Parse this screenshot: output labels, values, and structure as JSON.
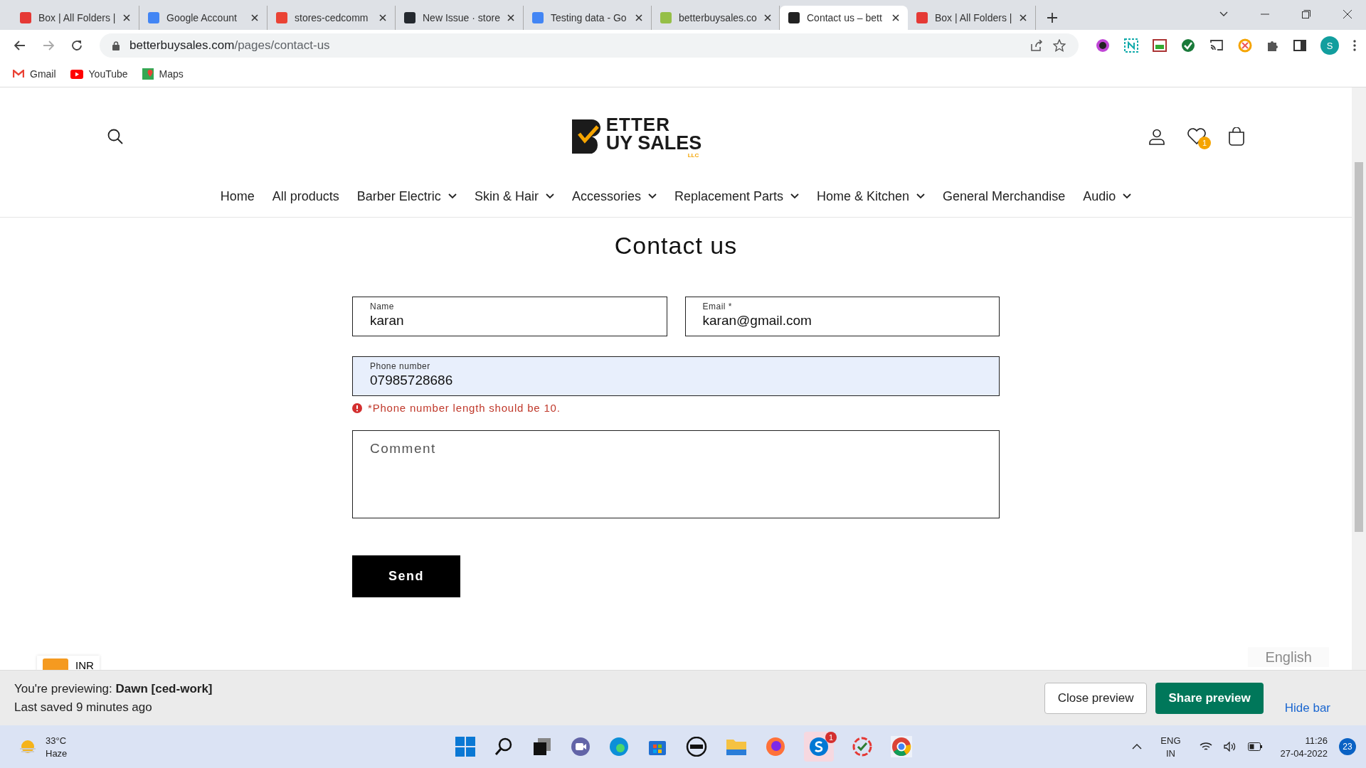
{
  "browser": {
    "tabs": [
      {
        "title": "Box | All Folders |",
        "selected": false
      },
      {
        "title": "Google Account",
        "selected": false
      },
      {
        "title": "stores-cedcomm",
        "selected": false
      },
      {
        "title": "New Issue · store",
        "selected": false
      },
      {
        "title": "Testing data - Go",
        "selected": false
      },
      {
        "title": "betterbuysales.co",
        "selected": false
      },
      {
        "title": "Contact us – bett",
        "selected": true
      },
      {
        "title": "Box | All Folders |",
        "selected": false
      }
    ],
    "url_host": "betterbuysales.com",
    "url_path": "/pages/contact-us",
    "profile_initial": "S",
    "bookmarks": [
      "Gmail",
      "YouTube",
      "Maps"
    ]
  },
  "store": {
    "logo": {
      "line1": "ETTER",
      "line2": "UY SALES",
      "sub": "LLC"
    },
    "wishlist_count": "1",
    "nav": [
      {
        "label": "Home",
        "has_dropdown": false
      },
      {
        "label": "All products",
        "has_dropdown": false
      },
      {
        "label": "Barber Electric",
        "has_dropdown": true
      },
      {
        "label": "Skin & Hair",
        "has_dropdown": true
      },
      {
        "label": "Accessories",
        "has_dropdown": true
      },
      {
        "label": "Replacement Parts",
        "has_dropdown": true
      },
      {
        "label": "Home & Kitchen",
        "has_dropdown": true
      },
      {
        "label": "General Merchandise",
        "has_dropdown": false
      },
      {
        "label": "Audio",
        "has_dropdown": true
      }
    ]
  },
  "contact": {
    "title": "Contact us",
    "name": {
      "label": "Name",
      "value": "karan"
    },
    "email": {
      "label": "Email *",
      "value": "karan@gmail.com"
    },
    "phone": {
      "label": "Phone number",
      "value": "07985728686",
      "invalid": true,
      "error": "*Phone number length should be 10."
    },
    "comment": {
      "placeholder": "Comment"
    },
    "send": "Send"
  },
  "currency": "INR",
  "language": "English",
  "preview_bar": {
    "previewing_prefix": "You're previewing: ",
    "theme": "Dawn [ced-work]",
    "saved": "Last saved 9 minutes ago",
    "close": "Close preview",
    "share": "Share preview",
    "hide": "Hide bar"
  },
  "taskbar": {
    "temp": "33°C",
    "weather": "Haze",
    "skype_badge": "1",
    "lang1": "ENG",
    "lang2": "IN",
    "time": "11:26",
    "date": "27-04-2022",
    "notifications": "23"
  }
}
